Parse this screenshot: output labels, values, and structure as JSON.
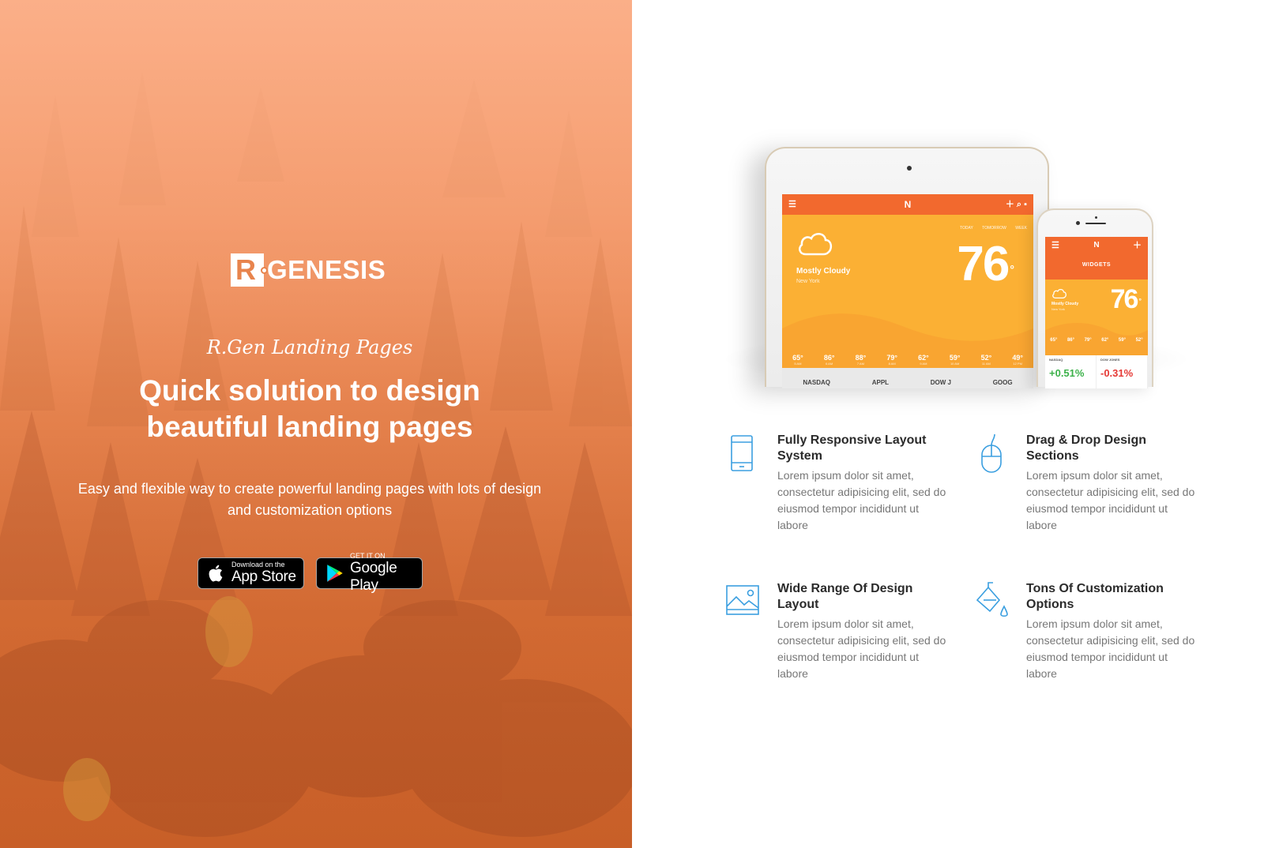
{
  "hero": {
    "logo_mark": "R",
    "logo_text": "GENESIS",
    "script_title": "R.Gen Landing Pages",
    "headline_line1": "Quick solution to design",
    "headline_line2": "beautiful landing pages",
    "subtitle": "Easy and flexible way to create powerful landing pages with lots of design and customization options",
    "app_store": {
      "small": "Download on the",
      "big": "App Store"
    },
    "google_play": {
      "small": "GET IT ON",
      "big": "Google Play"
    }
  },
  "devices": {
    "tablet": {
      "brand": "N",
      "tabs": [
        "TODAY",
        "TOMORROW",
        "WEEK"
      ],
      "condition": "Mostly Cloudy",
      "city": "New York",
      "temperature": "76",
      "degree": "°",
      "forecast": [
        {
          "temp": "65°",
          "time": "5 AM"
        },
        {
          "temp": "86°",
          "time": "6 AM"
        },
        {
          "temp": "88°",
          "time": "7 AM"
        },
        {
          "temp": "79°",
          "time": "8 AM"
        },
        {
          "temp": "62°",
          "time": "9 AM"
        },
        {
          "temp": "59°",
          "time": "10 AM"
        },
        {
          "temp": "52°",
          "time": "11 AM"
        },
        {
          "temp": "49°",
          "time": "12 PM"
        }
      ],
      "tickers": [
        "NASDAQ",
        "APPL",
        "DOW J",
        "GOOG"
      ]
    },
    "phone": {
      "brand": "N",
      "section": "WIDGETS",
      "condition": "Mostly Cloudy",
      "city": "New York",
      "temperature": "76",
      "degree": "°",
      "forecast": [
        "65°",
        "86°",
        "79°",
        "62°",
        "59°",
        "52°"
      ],
      "stocks": [
        {
          "name": "NASDAQ",
          "change": "+0.51%"
        },
        {
          "name": "DOW JONES",
          "change": "-0.31%"
        }
      ]
    }
  },
  "features": [
    {
      "icon": "mobile-phone-icon",
      "title": "Fully Responsive Layout System",
      "text": "Lorem ipsum dolor sit amet, consectetur adipisicing elit, sed do eiusmod tempor incididunt ut labore"
    },
    {
      "icon": "mouse-icon",
      "title": "Drag & Drop Design Sections",
      "text": "Lorem ipsum dolor sit amet, consectetur adipisicing elit, sed do eiusmod tempor incididunt ut labore"
    },
    {
      "icon": "image-icon",
      "title": "Wide Range Of Design Layout",
      "text": "Lorem ipsum dolor sit amet, consectetur adipisicing elit, sed do eiusmod tempor incididunt ut labore"
    },
    {
      "icon": "paint-bucket-icon",
      "title": "Tons Of Customization Options",
      "text": "Lorem ipsum dolor sit amet, consectetur adipisicing elit, sed do eiusmod tempor incididunt ut labore"
    }
  ],
  "colors": {
    "accent_blue": "#3b9fe0",
    "hero_orange": "#e07a44",
    "app_orange": "#f2692e",
    "app_yellow": "#fbb034"
  }
}
